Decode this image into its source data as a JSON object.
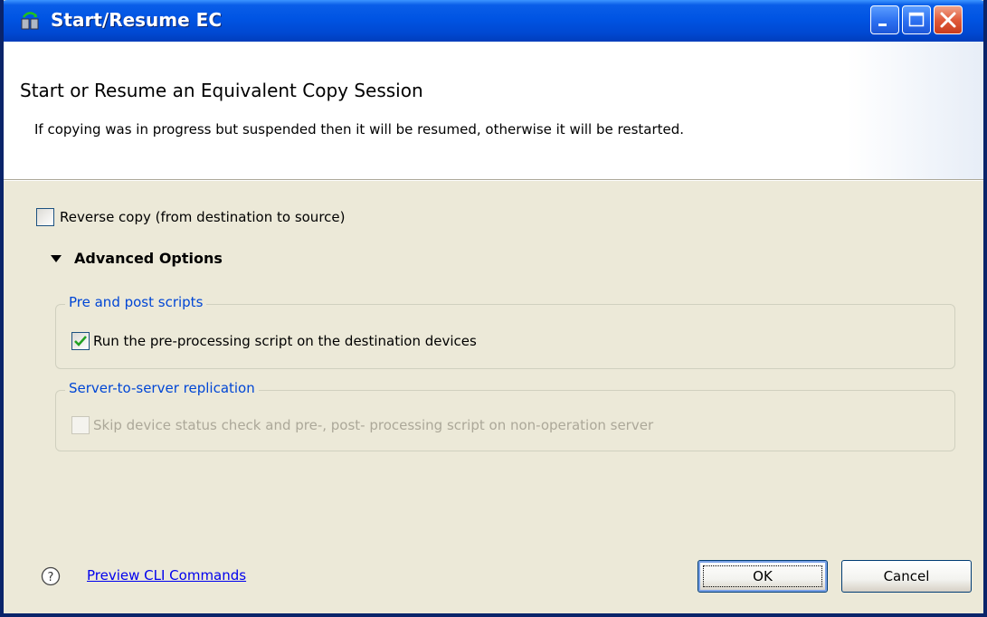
{
  "window": {
    "title": "Start/Resume EC",
    "controls": {
      "minimize": "minimize-icon",
      "maximize": "maximize-icon",
      "close": "close-icon"
    }
  },
  "header": {
    "title": "Start or Resume an Equivalent Copy Session",
    "description": "If copying was in progress but suspended then it will be resumed, otherwise it will be restarted."
  },
  "options": {
    "reverse_copy": {
      "label": "Reverse copy (from destination to source)",
      "checked": false
    }
  },
  "advanced": {
    "label": "Advanced Options",
    "expanded": true,
    "groups": [
      {
        "title": "Pre and post scripts",
        "checkbox": {
          "label": "Run the pre-processing script on the destination devices",
          "checked": true,
          "enabled": true
        }
      },
      {
        "title": "Server-to-server replication",
        "checkbox": {
          "label": "Skip device status check and pre-, post- processing script on non-operation server",
          "checked": false,
          "enabled": false
        }
      }
    ]
  },
  "footer": {
    "help_icon": "help-icon",
    "preview_link": "Preview CLI Commands",
    "ok_label": "OK",
    "cancel_label": "Cancel"
  },
  "colors": {
    "titlebar": "#0054e3",
    "dialog_bg": "#ece9d8",
    "group_title": "#0046d5",
    "link": "#0000ee",
    "check": "#21a121"
  }
}
